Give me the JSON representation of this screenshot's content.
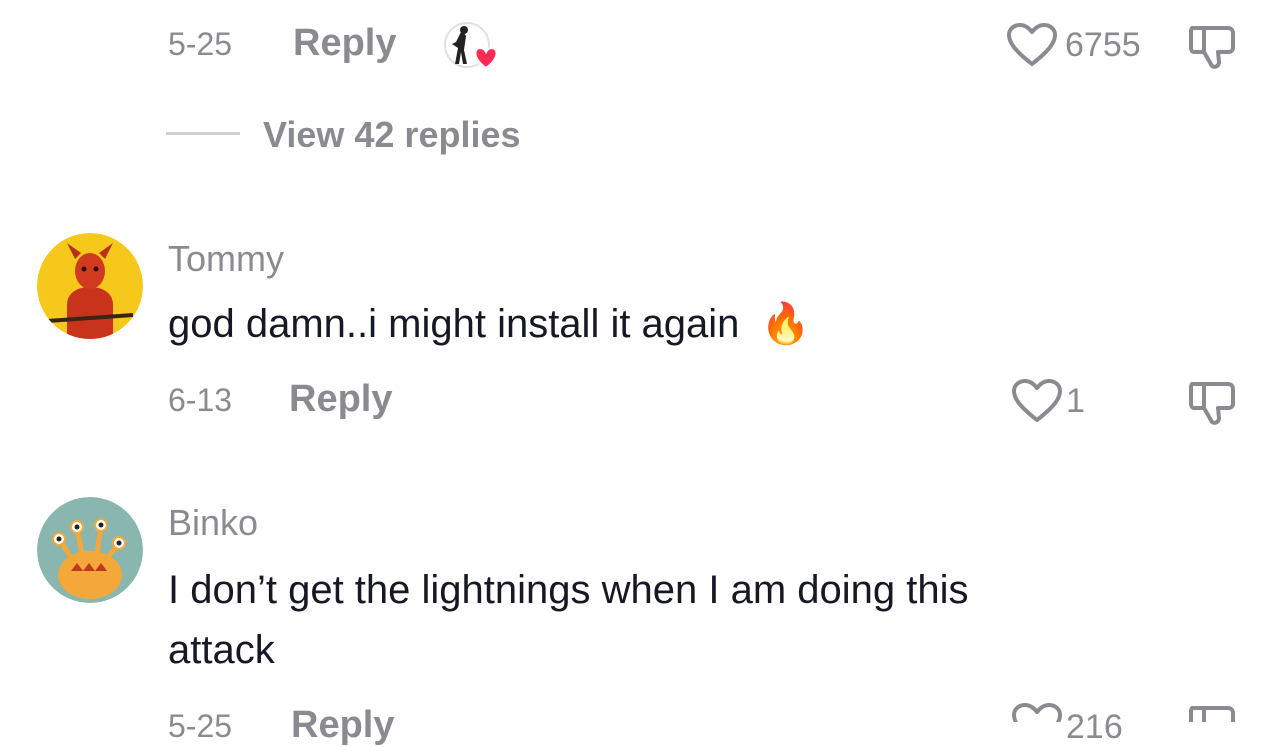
{
  "top_comment": {
    "date": "5-25",
    "reply_label": "Reply",
    "like_count": "6755",
    "view_replies_label": "View 42 replies"
  },
  "comments": [
    {
      "username": "Tommy",
      "text": "god damn..i might install it again",
      "emoji": "🔥",
      "date": "6-13",
      "reply_label": "Reply",
      "like_count": "1"
    },
    {
      "username": "Binko",
      "text_line1": "I don’t get the lightnings when I am doing this",
      "text_line2": "attack",
      "date": "5-25",
      "reply_label": "Reply",
      "like_count": "216"
    }
  ],
  "icons": {
    "like": "heart-outline-icon",
    "dislike": "thumbs-down-icon",
    "creator_liked": "creator-liked-avatar-icon"
  },
  "colors": {
    "meta_gray": "#8a8b91",
    "text_dark": "#161823",
    "heart_red": "#fe2c55",
    "avatar_yellow": "#f6c81b",
    "avatar_teal": "#8ab6b0"
  }
}
